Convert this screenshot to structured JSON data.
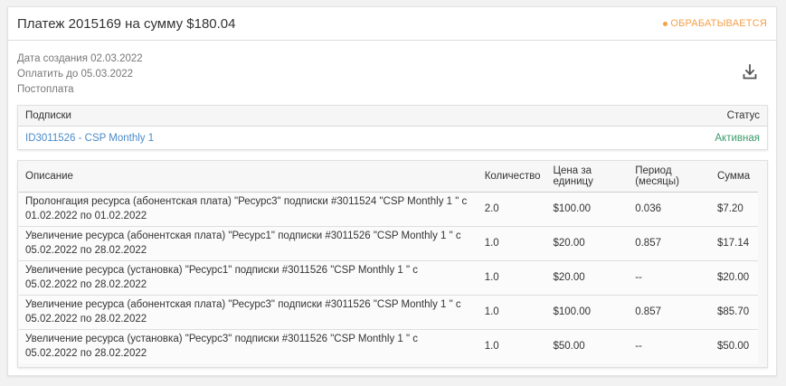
{
  "header": {
    "title": "Платеж 2015169 на сумму $180.04",
    "status": "ОБРАБАТЫВАЕТСЯ",
    "status_color": "#f5a04a"
  },
  "meta": {
    "created": "Дата создания 02.03.2022",
    "pay_until": "Оплатить до 05.03.2022",
    "type": "Постоплата"
  },
  "download_icon": "download-icon",
  "subscriptions": {
    "header_label": "Подписки",
    "status_header": "Статус",
    "rows": [
      {
        "name": "ID3011526 - CSP Monthly 1",
        "status": "Активная"
      }
    ]
  },
  "items": {
    "columns": {
      "description": "Описание",
      "quantity": "Количество",
      "unit_price": "Цена за единицу",
      "period": "Период (месяцы)",
      "total": "Сумма"
    },
    "rows": [
      {
        "description": "Пролонгация ресурса (абонентская плата) \"Ресурс3\" подписки #3011524 \"CSP Monthly 1 \" с 01.02.2022 по 01.02.2022",
        "quantity": "2.0",
        "unit_price": "$100.00",
        "period": "0.036",
        "total": "$7.20"
      },
      {
        "description": "Увеличение ресурса (абонентская плата) \"Ресурс1\" подписки #3011526 \"CSP Monthly 1 \" с 05.02.2022 по 28.02.2022",
        "quantity": "1.0",
        "unit_price": "$20.00",
        "period": "0.857",
        "total": "$17.14"
      },
      {
        "description": "Увеличение ресурса (установка) \"Ресурс1\" подписки #3011526 \"CSP Monthly 1 \" с 05.02.2022 по 28.02.2022",
        "quantity": "1.0",
        "unit_price": "$20.00",
        "period": "--",
        "total": "$20.00"
      },
      {
        "description": "Увеличение ресурса (абонентская плата) \"Ресурс3\" подписки #3011526 \"CSP Monthly 1 \" с 05.02.2022 по 28.02.2022",
        "quantity": "1.0",
        "unit_price": "$100.00",
        "period": "0.857",
        "total": "$85.70"
      },
      {
        "description": "Увеличение ресурса (установка) \"Ресурс3\" подписки #3011526 \"CSP Monthly 1 \" с 05.02.2022 по 28.02.2022",
        "quantity": "1.0",
        "unit_price": "$50.00",
        "period": "--",
        "total": "$50.00"
      }
    ]
  }
}
